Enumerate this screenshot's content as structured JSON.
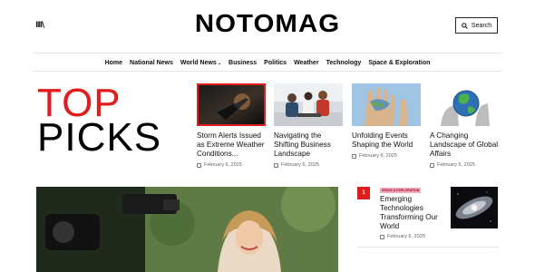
{
  "header": {
    "menu_glyph": "III\\",
    "logo": "NOTOMAG",
    "search_label": "Search"
  },
  "nav": {
    "items": [
      "Home",
      "National News",
      "World News",
      "Business",
      "Politics",
      "Weather",
      "Technology",
      "Space & Exploration"
    ]
  },
  "top_picks": {
    "line1": "TOP",
    "line2": "PICKS"
  },
  "cards": [
    {
      "title": "Storm Alerts Issued as Extreme Weather Conditions...",
      "date": "February 6, 2025"
    },
    {
      "title": "Navigating the Shifting Business Landscape",
      "date": "February 6, 2025"
    },
    {
      "title": "Unfolding Events Shaping the World",
      "date": "February 6, 2025"
    },
    {
      "title": "A Changing Landscape of Global Affairs",
      "date": "February 6, 2025"
    }
  ],
  "sidebar": {
    "number": "1",
    "badge": "SPACE & EXPLORATION",
    "title": "Emerging Technologies Transforming Our World",
    "date": "February 6, 2025"
  },
  "colors": {
    "accent": "#e01c1c",
    "badge_bg": "#f7a8b8"
  }
}
